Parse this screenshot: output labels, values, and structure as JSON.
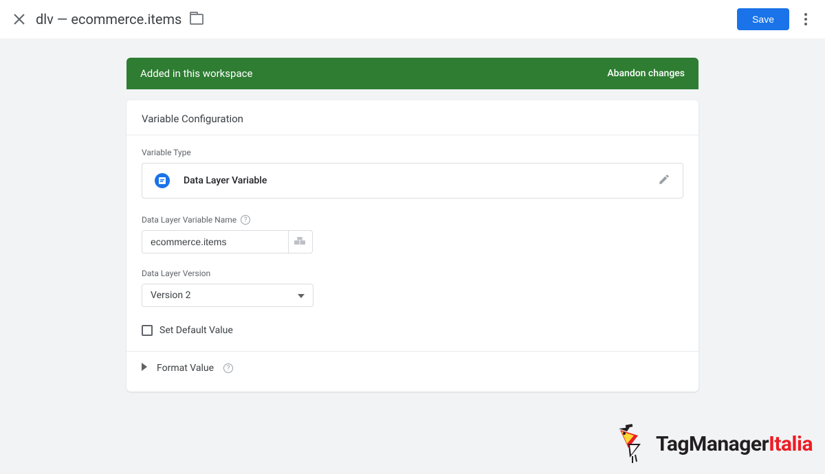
{
  "header": {
    "title": "dlv — ecommerce.items",
    "save_label": "Save"
  },
  "banner": {
    "text": "Added in this workspace",
    "action": "Abandon changes"
  },
  "card": {
    "title": "Variable Configuration",
    "sections": {
      "variable_type_label": "Variable Type",
      "variable_type_name": "Data Layer Variable",
      "dlv_name_label": "Data Layer Variable Name",
      "dlv_name_value": "ecommerce.items",
      "dlv_version_label": "Data Layer Version",
      "dlv_version_value": "Version 2",
      "set_default_label": "Set Default Value",
      "format_value_label": "Format Value"
    }
  },
  "watermark": {
    "text1": "TagManager",
    "text2": "Italia"
  }
}
